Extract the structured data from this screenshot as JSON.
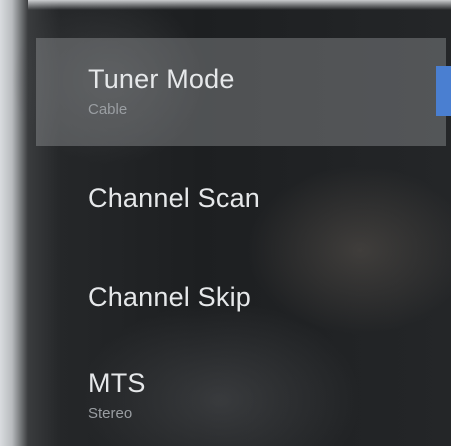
{
  "menu": {
    "items": [
      {
        "title": "Tuner Mode",
        "value": "Cable",
        "selected": true
      },
      {
        "title": "Channel Scan"
      },
      {
        "title": "Channel Skip"
      },
      {
        "title": "MTS",
        "value": "Stereo"
      }
    ]
  },
  "colors": {
    "focus_accent": "#4a7fd1",
    "selected_background": "#8f9194",
    "title_text": "#e6e8ea",
    "subtitle_text": "#9a9ea2"
  }
}
